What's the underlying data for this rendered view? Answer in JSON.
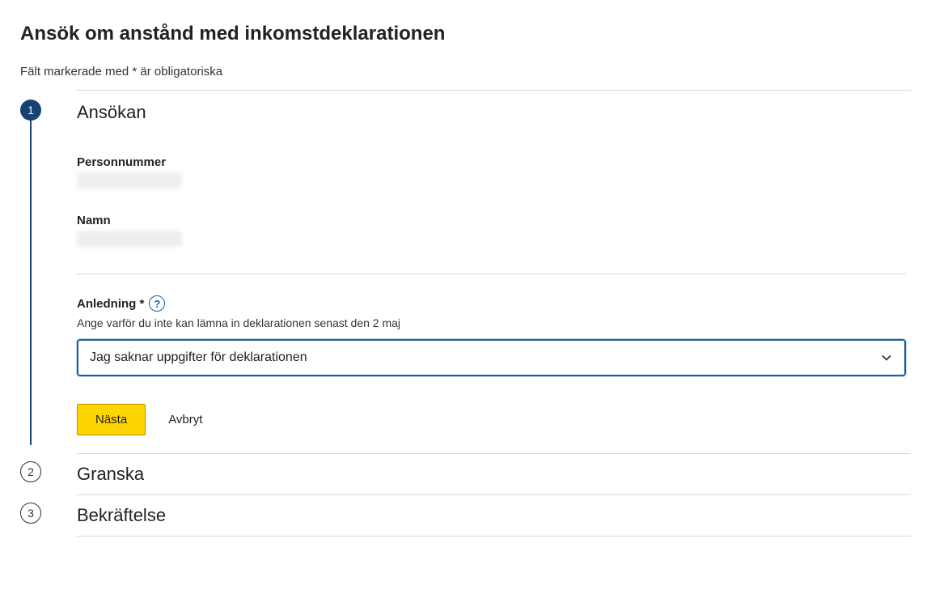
{
  "page": {
    "title": "Ansök om anstånd med inkomstdeklarationen",
    "mandatory_note": "Fält markerade med * är obligatoriska"
  },
  "steps": {
    "s1": {
      "number": "1",
      "title": "Ansökan"
    },
    "s2": {
      "number": "2",
      "title": "Granska"
    },
    "s3": {
      "number": "3",
      "title": "Bekräftelse"
    }
  },
  "applicant": {
    "personnummer_label": "Personnummer",
    "personnummer_value": "",
    "namn_label": "Namn",
    "namn_value": ""
  },
  "reason": {
    "label": "Anledning *",
    "help_symbol": "?",
    "hint": "Ange varför du inte kan lämna in deklarationen senast den 2 maj",
    "selected": "Jag saknar uppgifter för deklarationen"
  },
  "actions": {
    "next": "Nästa",
    "cancel": "Avbryt"
  },
  "colors": {
    "accent": "#154273",
    "focus": "#1a5fa0",
    "primary_btn": "#ffd500"
  }
}
